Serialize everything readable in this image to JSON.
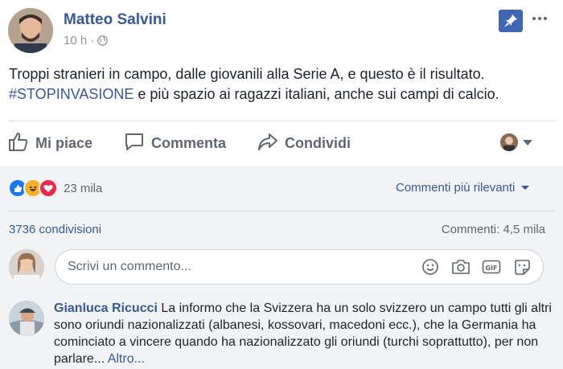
{
  "post": {
    "author": "Matteo Salvini",
    "time": "10 h",
    "separator": "·",
    "text_before": "Troppi stranieri in campo, dalle giovanili alla Serie A, e questo è il risultato.",
    "hashtag": "#STOPINVASIONE",
    "text_after": " e più spazio ai ragazzi italiani, anche sui campi di calcio."
  },
  "actions": {
    "like": "Mi piace",
    "comment": "Commenta",
    "share": "Condividi"
  },
  "stats": {
    "reactions_count": "23 mila",
    "sort_label": "Commenti più rilevanti",
    "shares": "3736 condivisioni",
    "comments": "Commenti: 4,5 mila"
  },
  "composer": {
    "placeholder": "Scrivi un commento..."
  },
  "comment": {
    "author": "Gianluca Ricucci",
    "text": " La informo che la Svizzera ha un solo svizzero un campo tutti gli altri sono oriundi nazionalizzati (albanesi, kossovari, macedoni ecc.), che la Germania ha cominciato a vincere quando ha nazionalizzato gli oriundi (turchi soprattutto), per non parlare... ",
    "more": "Altro..."
  },
  "colors": {
    "link": "#365899",
    "accent": "#4267b2",
    "muted": "#606770",
    "background_gray": "#f2f3f5"
  },
  "icons": [
    "globe-icon",
    "pin-icon",
    "more-icon",
    "like-icon",
    "comment-icon",
    "share-icon",
    "emoji-icon",
    "camera-icon",
    "gif-icon",
    "sticker-icon"
  ]
}
